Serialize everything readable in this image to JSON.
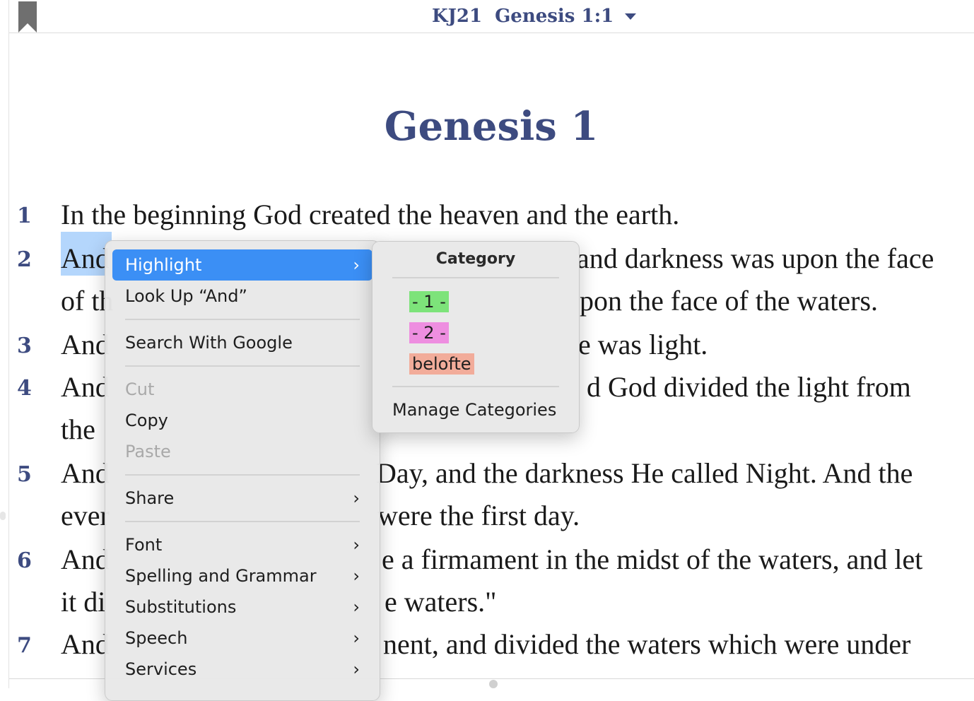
{
  "header": {
    "version": "KJ21",
    "reference": "Genesis 1:1"
  },
  "chapter_title": "Genesis 1",
  "verses": [
    {
      "num": "1"
    },
    {
      "num": "2"
    },
    {
      "num": "3"
    },
    {
      "num": "4"
    },
    {
      "num": "5"
    },
    {
      "num": "6"
    },
    {
      "num": "7"
    }
  ],
  "lines": [
    "In the beginning God created the heaven and the earth.",
    "And",
    "of th",
    "And",
    "And",
    "the",
    "And",
    "ever",
    "And",
    "it di",
    "And"
  ],
  "lines_right": [
    "and darkness was upon the face",
    "pon the face of the waters.",
    "e was light.",
    "d God divided the light from",
    "Day, and the darkness He called Night. And the",
    "were the first day.",
    "e a firmament in the midst of the waters, and let",
    "e waters.\"",
    "nent, and divided the waters which were under"
  ],
  "context_menu": {
    "items": {
      "highlight": "Highlight",
      "lookup": "Look Up “And”",
      "search_google": "Search With Google",
      "cut": "Cut",
      "copy": "Copy",
      "paste": "Paste",
      "share": "Share",
      "font": "Font",
      "spelling": "Spelling and Grammar",
      "substitutions": "Substitutions",
      "speech": "Speech",
      "services": "Services"
    },
    "chevron": "›"
  },
  "submenu": {
    "heading": "Category",
    "categories": [
      {
        "label": "- 1 -",
        "color": "#7de37a"
      },
      {
        "label": "- 2 -",
        "color": "#ee8ee0"
      },
      {
        "label": "belofte",
        "color": "#f2ac9a"
      }
    ],
    "manage": "Manage Categories"
  },
  "colors": {
    "accent": "#3b8ff5",
    "header_text": "#3d4b80",
    "selection": "#b4d6fc"
  }
}
